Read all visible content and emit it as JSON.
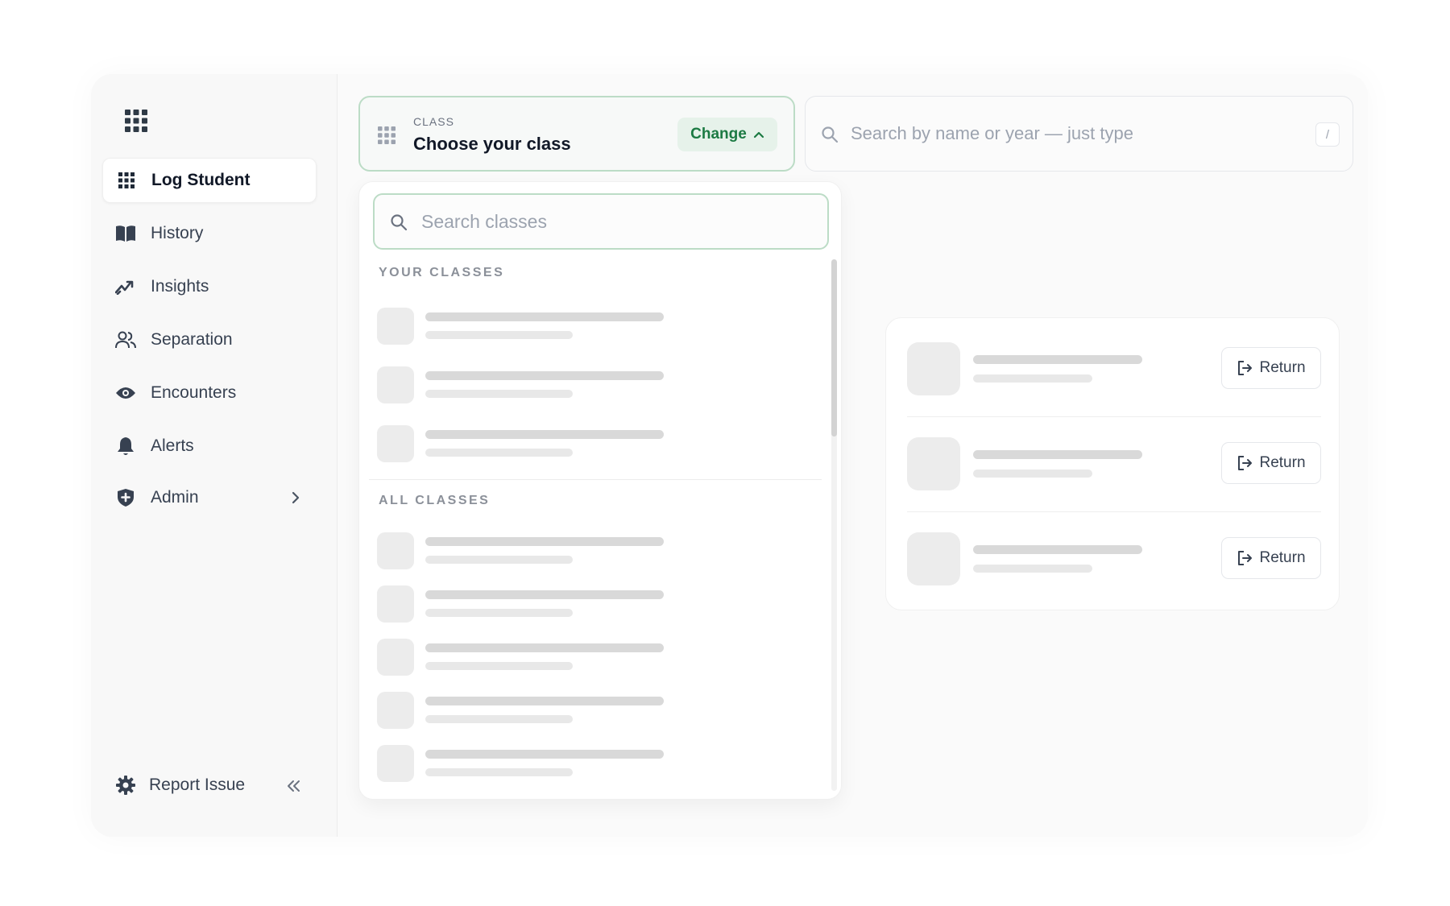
{
  "sidebar": {
    "items": [
      {
        "label": "Log Student",
        "icon": "grid-icon",
        "active": true
      },
      {
        "label": "History",
        "icon": "book-icon"
      },
      {
        "label": "Insights",
        "icon": "trend-icon"
      },
      {
        "label": "Separation",
        "icon": "users-icon"
      },
      {
        "label": "Encounters",
        "icon": "eye-icon"
      },
      {
        "label": "Alerts",
        "icon": "bell-icon"
      },
      {
        "label": "Admin",
        "icon": "shield-icon",
        "has_submenu": true
      }
    ],
    "footer": {
      "report_label": "Report Issue"
    }
  },
  "class_selector": {
    "kicker": "CLASS",
    "title": "Choose your class",
    "change_label": "Change"
  },
  "student_search": {
    "placeholder": "Search by name or year — just type",
    "shortcut": "/"
  },
  "dropdown": {
    "search_placeholder": "Search classes",
    "your_classes_label": "YOUR CLASSES",
    "all_classes_label": "ALL CLASSES"
  },
  "returns": {
    "button_label": "Return"
  },
  "colors": {
    "accent_green": "#1c7a43",
    "accent_green_bg": "#e6f2ea",
    "border_green": "#bcdcc6"
  }
}
